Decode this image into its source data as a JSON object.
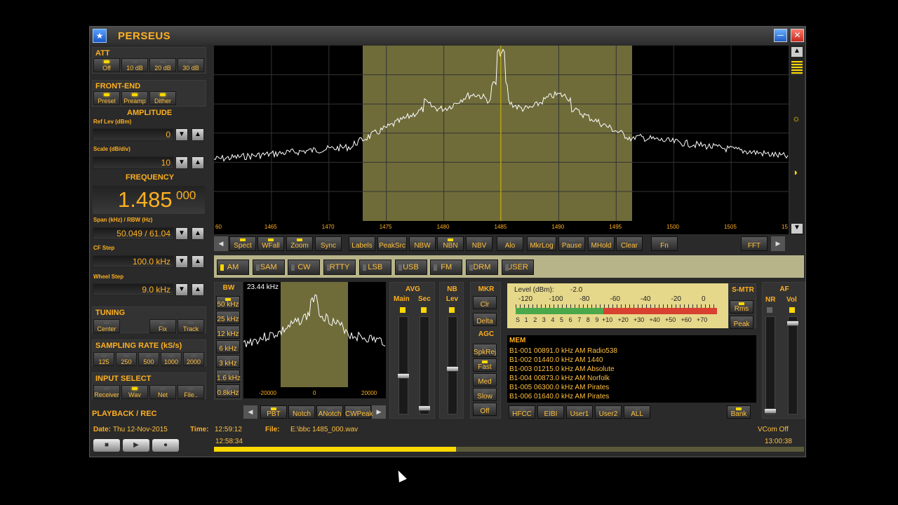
{
  "app": {
    "title": "PERSEUS",
    "icon": "app-logo-icon"
  },
  "window_controls": {
    "minimize_icon": "minimize-icon",
    "close_icon": "close-icon"
  },
  "att": {
    "title": "ATT",
    "buttons": [
      {
        "label": "Off",
        "on": true
      },
      {
        "label": "10 dB",
        "on": false
      },
      {
        "label": "20 dB",
        "on": false
      },
      {
        "label": "30 dB",
        "on": false
      }
    ]
  },
  "frontend": {
    "title": "FRONT-END",
    "buttons": [
      {
        "label": "Presel",
        "on": true
      },
      {
        "label": "Preamp",
        "on": true
      },
      {
        "label": "Dither",
        "on": true
      }
    ]
  },
  "amplitude": {
    "title": "AMPLITUDE",
    "ref_label": "Ref Lev (dBm)",
    "ref_value": "0",
    "scale_label": "Scale (dB/div)",
    "scale_value": "10"
  },
  "frequency": {
    "title": "FREQUENCY",
    "main": "1.485",
    "sub": "000",
    "span_label": "Span (kHz) / RBW (Hz)",
    "span_value": "50.049 / 61.04",
    "cfstep_label": "CF Step",
    "cfstep_value": "100.0 kHz",
    "wheel_label": "Wheel Step",
    "wheel_value": "9.0 kHz"
  },
  "tuning": {
    "title": "TUNING",
    "buttons": [
      {
        "label": "Center",
        "on": false
      },
      {
        "label": "Fix",
        "on": false
      },
      {
        "label": "Track",
        "on": false
      }
    ]
  },
  "sampling": {
    "title": "SAMPLING RATE (kS/s)",
    "buttons": [
      {
        "label": "125",
        "on": false
      },
      {
        "label": "250",
        "on": false
      },
      {
        "label": "500",
        "on": false
      },
      {
        "label": "1000",
        "on": false
      },
      {
        "label": "2000",
        "on": false
      }
    ]
  },
  "input": {
    "title": "INPUT SELECT",
    "buttons": [
      {
        "label": "Receiver",
        "on": false
      },
      {
        "label": "Wav",
        "on": true
      },
      {
        "label": "Net",
        "on": false
      },
      {
        "label": "File..",
        "on": false
      }
    ]
  },
  "playback": {
    "title": "PLAYBACK / REC",
    "date_label": "Date:",
    "date_value": "Thu 12-Nov-2015",
    "time_label": "Time:",
    "time_value": "12:59:12",
    "file_label": "File:",
    "file_value": "E:\\bbc 1485_000.wav",
    "start_time": "12:58:34",
    "end_time": "13:00:38",
    "vcom": "VCom Off",
    "progress": 0.41
  },
  "spectrum": {
    "x_ticks": [
      "60",
      "1465",
      "1470",
      "1475",
      "1480",
      "1485",
      "1490",
      "1495",
      "1500",
      "1505",
      "15"
    ]
  },
  "toolbar": [
    {
      "label": "Spect",
      "on": true
    },
    {
      "label": "WFall",
      "on": true
    },
    {
      "label": "Zoom",
      "on": true
    },
    {
      "label": "Sync",
      "on": false
    },
    {
      "label": "Labels",
      "on": false
    },
    {
      "label": "PeakSrc",
      "on": false
    },
    {
      "label": "NBW",
      "on": false
    },
    {
      "label": "NBN",
      "on": true
    },
    {
      "label": "NBV",
      "on": false
    },
    {
      "label": "Alo",
      "on": false
    },
    {
      "label": "MkrLog",
      "on": false
    },
    {
      "label": "Pause",
      "on": false
    },
    {
      "label": "MHold",
      "on": false
    },
    {
      "label": "Clear",
      "on": false
    },
    {
      "label": "Fn",
      "on": false
    },
    {
      "label": "FFT",
      "on": false
    }
  ],
  "modes": [
    {
      "label": "AM",
      "on": true
    },
    {
      "label": "SAM",
      "on": false
    },
    {
      "label": "CW",
      "on": false
    },
    {
      "label": "RTTY",
      "on": false
    },
    {
      "label": "LSB",
      "on": false
    },
    {
      "label": "USB",
      "on": false
    },
    {
      "label": "FM",
      "on": false
    },
    {
      "label": "DRM",
      "on": false
    },
    {
      "label": "USER",
      "on": false
    }
  ],
  "bw": {
    "title": "BW",
    "buttons": [
      {
        "label": "50 kHz",
        "on": true
      },
      {
        "label": "25 kHz",
        "on": false
      },
      {
        "label": "12 kHz",
        "on": false
      },
      {
        "label": "6 kHz",
        "on": false
      },
      {
        "label": "3 kHz",
        "on": false
      },
      {
        "label": "1.6 kHz",
        "on": false
      },
      {
        "label": "0.8kHz",
        "on": false
      }
    ],
    "bw_readout": "23.44 kHz",
    "x_ticks": [
      "-20000",
      "0",
      "20000"
    ],
    "bottom_buttons": [
      {
        "label": "PBT",
        "on": true
      },
      {
        "label": "Notch",
        "on": false
      },
      {
        "label": "ANotch",
        "on": false
      },
      {
        "label": "CWPeak",
        "on": false
      }
    ]
  },
  "avg": {
    "title": "AVG",
    "main": "Main",
    "sec": "Sec"
  },
  "nb": {
    "title": "NB",
    "lev": "Lev"
  },
  "mkr": {
    "title": "MKR",
    "buttons": [
      {
        "label": "Clr",
        "on": false
      },
      {
        "label": "Delta",
        "on": false
      }
    ]
  },
  "agc": {
    "title": "AGC",
    "buttons": [
      {
        "label": "SpkRej",
        "on": false
      },
      {
        "label": "Fast",
        "on": true
      },
      {
        "label": "Med",
        "on": false
      },
      {
        "label": "Slow",
        "on": false
      },
      {
        "label": "Off",
        "on": false
      }
    ]
  },
  "level": {
    "label": "Level (dBm):",
    "value": "-2.0",
    "dbm_ticks": [
      "-120",
      "-100",
      "-80",
      "-60",
      "-40",
      "-20",
      "0"
    ],
    "s_ticks": [
      "S",
      "1",
      "2",
      "3",
      "4",
      "5",
      "6",
      "7",
      "8",
      "9",
      "+10",
      "+20",
      "+30",
      "+40",
      "+50",
      "+60",
      "+70"
    ]
  },
  "smtr": {
    "title": "S-MTR",
    "buttons": [
      {
        "label": "Rms",
        "on": true
      },
      {
        "label": "Peak",
        "on": false
      }
    ]
  },
  "af": {
    "title": "AF",
    "nr": "NR",
    "vol": "Vol"
  },
  "mem": {
    "title": "MEM",
    "rows": [
      "B1-001 00891.0 kHz  AM  Radio538",
      "B1-002 01440.0 kHz  AM  1440",
      "B1-003 01215.0 kHz  AM  Absolute",
      "B1-004 00873.0 kHz  AM  Norfolk",
      "B1-005 06300.0 kHz  AM  Pirates",
      "B1-006 01640.0 kHz  AM  Pirates"
    ],
    "buttons": [
      {
        "label": "HFCC",
        "on": false
      },
      {
        "label": "EIBI",
        "on": false
      },
      {
        "label": "User1",
        "on": false
      },
      {
        "label": "User2",
        "on": false
      },
      {
        "label": "ALL",
        "on": false
      }
    ],
    "bank_label": "Bank"
  },
  "colors": {
    "accent": "#ffb020",
    "led_on": "#ffd800",
    "filter_band": "#6f6c3a",
    "trace": "#ffffff",
    "marker": "#ffd800"
  }
}
